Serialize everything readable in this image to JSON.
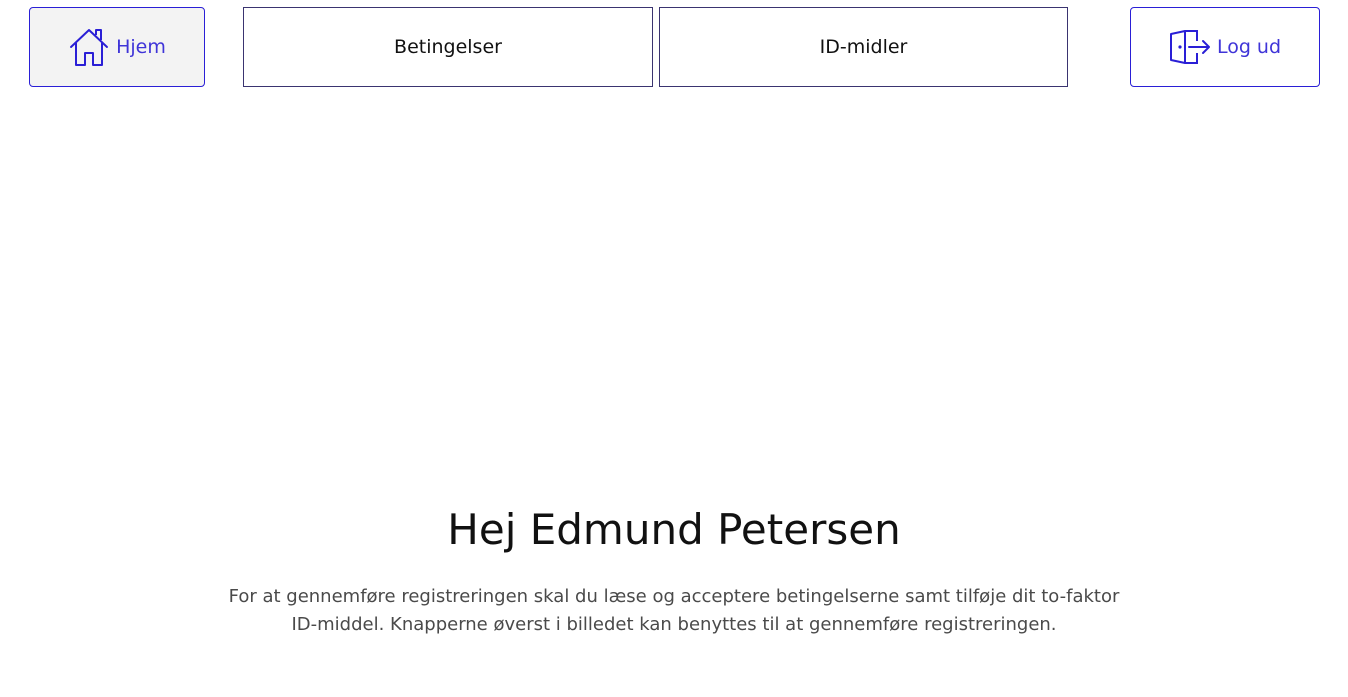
{
  "nav": {
    "home_label": "Hjem",
    "terms_label": "Betingelser",
    "id_label": "ID-midler",
    "logout_label": "Log ud"
  },
  "icons": {
    "home": "home-icon",
    "logout": "door-exit-icon"
  },
  "colors": {
    "accent": "#2a1fd6",
    "text": "#111111",
    "body_text": "#4a4a4a"
  },
  "main": {
    "greeting": "Hej Edmund Petersen",
    "info": "For at gennemføre registreringen skal du læse og acceptere betingelserne samt tilføje dit to-faktor ID-middel. Knapperne øverst i billedet kan benyttes til at gennemføre registreringen."
  }
}
